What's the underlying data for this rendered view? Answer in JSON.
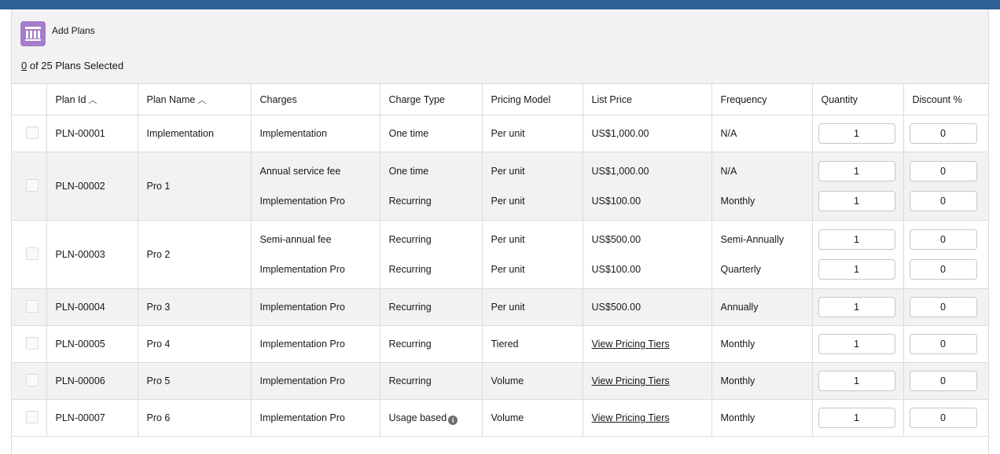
{
  "header": {
    "title": "Add Plans",
    "selected_count": "0",
    "selected_suffix": " of 25 Plans Selected"
  },
  "columns": {
    "plan_id": "Plan Id",
    "plan_name": "Plan Name",
    "charges": "Charges",
    "charge_type": "Charge Type",
    "pricing_model": "Pricing Model",
    "list_price": "List Price",
    "frequency": "Frequency",
    "quantity": "Quantity",
    "discount": "Discount %"
  },
  "sort_glyph": "︿",
  "rows": [
    {
      "id": "PLN-00001",
      "name": "Implementation",
      "charges": [
        {
          "charge": "Implementation",
          "type": "One time",
          "model": "Per unit",
          "price": "US$1,000.00",
          "freq": "N/A",
          "qty": "1",
          "disc": "0"
        }
      ]
    },
    {
      "id": "PLN-00002",
      "name": "Pro 1",
      "charges": [
        {
          "charge": "Annual service fee",
          "type": "One time",
          "model": "Per unit",
          "price": "US$1,000.00",
          "freq": "N/A",
          "qty": "1",
          "disc": "0"
        },
        {
          "charge": "Implementation Pro",
          "type": "Recurring",
          "model": "Per unit",
          "price": "US$100.00",
          "freq": "Monthly",
          "qty": "1",
          "disc": "0"
        }
      ]
    },
    {
      "id": "PLN-00003",
      "name": "Pro 2",
      "charges": [
        {
          "charge": "Semi-annual fee",
          "type": "Recurring",
          "model": "Per unit",
          "price": "US$500.00",
          "freq": "Semi-Annually",
          "qty": "1",
          "disc": "0"
        },
        {
          "charge": "Implementation Pro",
          "type": "Recurring",
          "model": "Per unit",
          "price": "US$100.00",
          "freq": "Quarterly",
          "qty": "1",
          "disc": "0"
        }
      ]
    },
    {
      "id": "PLN-00004",
      "name": "Pro 3",
      "charges": [
        {
          "charge": "Implementation Pro",
          "type": "Recurring",
          "model": "Per unit",
          "price": "US$500.00",
          "freq": "Annually",
          "qty": "1",
          "disc": "0"
        }
      ]
    },
    {
      "id": "PLN-00005",
      "name": "Pro 4",
      "charges": [
        {
          "charge": "Implementation Pro",
          "type": "Recurring",
          "model": "Tiered",
          "price": "View Pricing Tiers",
          "freq": "Monthly",
          "qty": "1",
          "disc": "0"
        }
      ]
    },
    {
      "id": "PLN-00006",
      "name": "Pro 5",
      "charges": [
        {
          "charge": "Implementation Pro",
          "type": "Recurring",
          "model": "Volume",
          "price": "View Pricing Tiers",
          "freq": "Monthly",
          "qty": "1",
          "disc": "0"
        }
      ]
    },
    {
      "id": "PLN-00007",
      "name": "Pro 6",
      "charges": [
        {
          "charge": "Implementation Pro",
          "type": "Usage based",
          "model": "Volume",
          "price": "View Pricing Tiers",
          "freq": "Monthly",
          "qty": "1",
          "disc": "0"
        }
      ]
    }
  ]
}
